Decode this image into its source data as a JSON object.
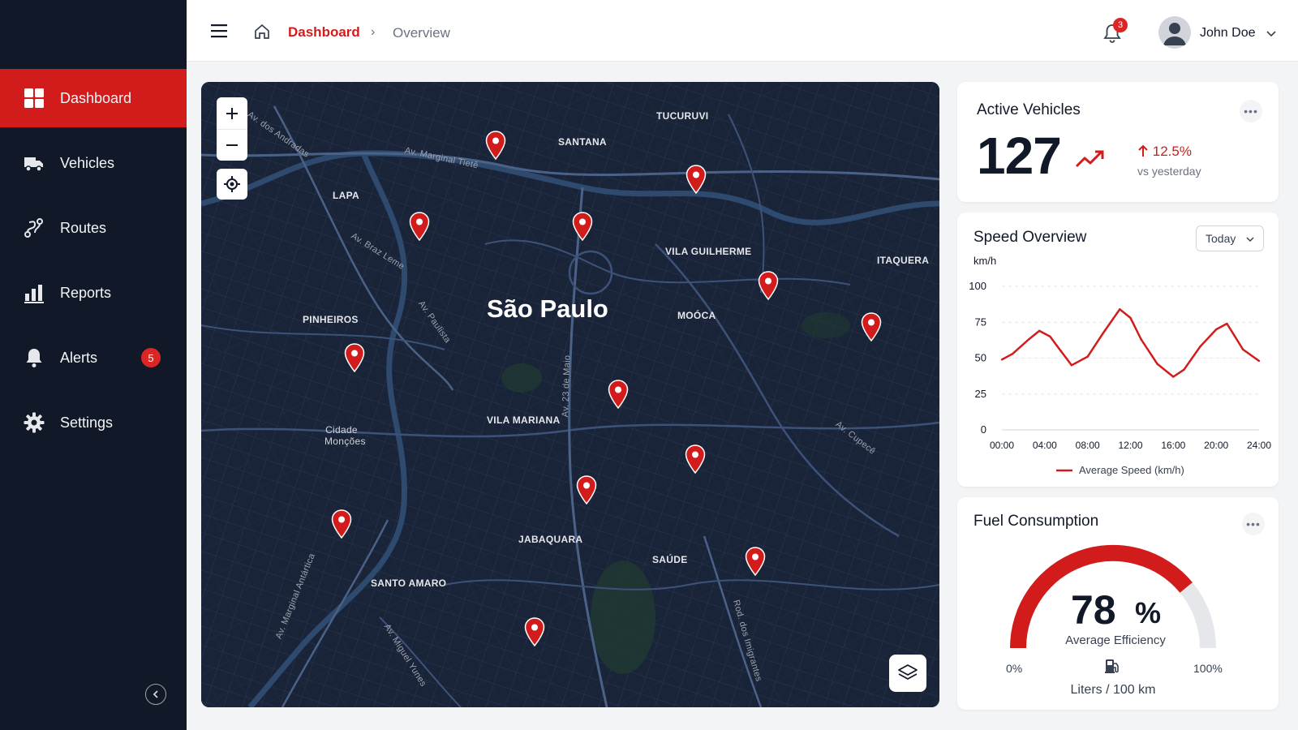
{
  "sidebar": {
    "items": [
      {
        "label": "Dashboard",
        "icon": "grid-icon"
      },
      {
        "label": "Vehicles",
        "icon": "truck-icon"
      },
      {
        "label": "Routes",
        "icon": "route-icon"
      },
      {
        "label": "Reports",
        "icon": "bar-chart-icon"
      },
      {
        "label": "Alerts",
        "icon": "bell-icon",
        "badge": "5"
      },
      {
        "label": "Settings",
        "icon": "gear-icon"
      }
    ],
    "active": "Dashboard"
  },
  "header": {
    "breadcrumb_active": "Dashboard",
    "breadcrumb_sep": "›",
    "breadcrumb_current": "Overview",
    "notification_count": "3",
    "user_name": "John Doe"
  },
  "map": {
    "city": "São Paulo",
    "districts": [
      "TUCURUVI",
      "SANTANA",
      "LAPA",
      "VILA GUILHERME",
      "ITAQUERA",
      "PINHEIROS",
      "MOÓCA",
      "Cidade Monções",
      "VILA MARIANA",
      "JABAQUARA",
      "SAÚDE",
      "SANTO AMARO"
    ],
    "streets": [
      "Av. Marginal Tietê",
      "Av. Braz Leme",
      "Av. Paulista",
      "Av. 23 de Maio",
      "Av. Cupecê",
      "Av. Marginal Antártica",
      "Av. Miguel Yunes",
      "Rod. dos Imigrantes",
      "Av. dos Andradas"
    ]
  },
  "cards": {
    "active": {
      "title": "Active Vehicles",
      "value": "127",
      "change": "12.5%",
      "change_sub": "vs yesterday",
      "accent": "#d21c1c"
    },
    "speed": {
      "title": "Speed Overview",
      "range": "Today"
    },
    "fuel": {
      "title": "Fuel Consumption",
      "value": "78",
      "unit": "%",
      "label": "Average Efficiency",
      "min_label": "0%",
      "max_label": "100%",
      "footer": "Liters / 100 km",
      "fraction": 0.78
    }
  },
  "chart_data": {
    "type": "line",
    "ylabel": "km/h",
    "ylim": [
      0,
      100
    ],
    "yticks": [
      0,
      25,
      50,
      75,
      100
    ],
    "xticks": [
      "00:00",
      "04:00",
      "08:00",
      "12:00",
      "16:00",
      "20:00",
      "24:00"
    ],
    "x": [
      0,
      1,
      2.5,
      3.5,
      4.5,
      5.5,
      6.5,
      8,
      9.5,
      11,
      12,
      13,
      14.5,
      16,
      17,
      18.5,
      20,
      21,
      22.5,
      24
    ],
    "series": [
      {
        "name": "Average Speed (km/h)",
        "values": [
          49,
          53,
          63,
          69,
          65,
          55,
          45,
          51,
          68,
          84,
          78,
          63,
          46,
          37,
          42,
          58,
          70,
          74,
          56,
          48
        ]
      }
    ],
    "grid": "dashed-horizontal",
    "legend": "bottom",
    "color": "#d21c1c"
  }
}
